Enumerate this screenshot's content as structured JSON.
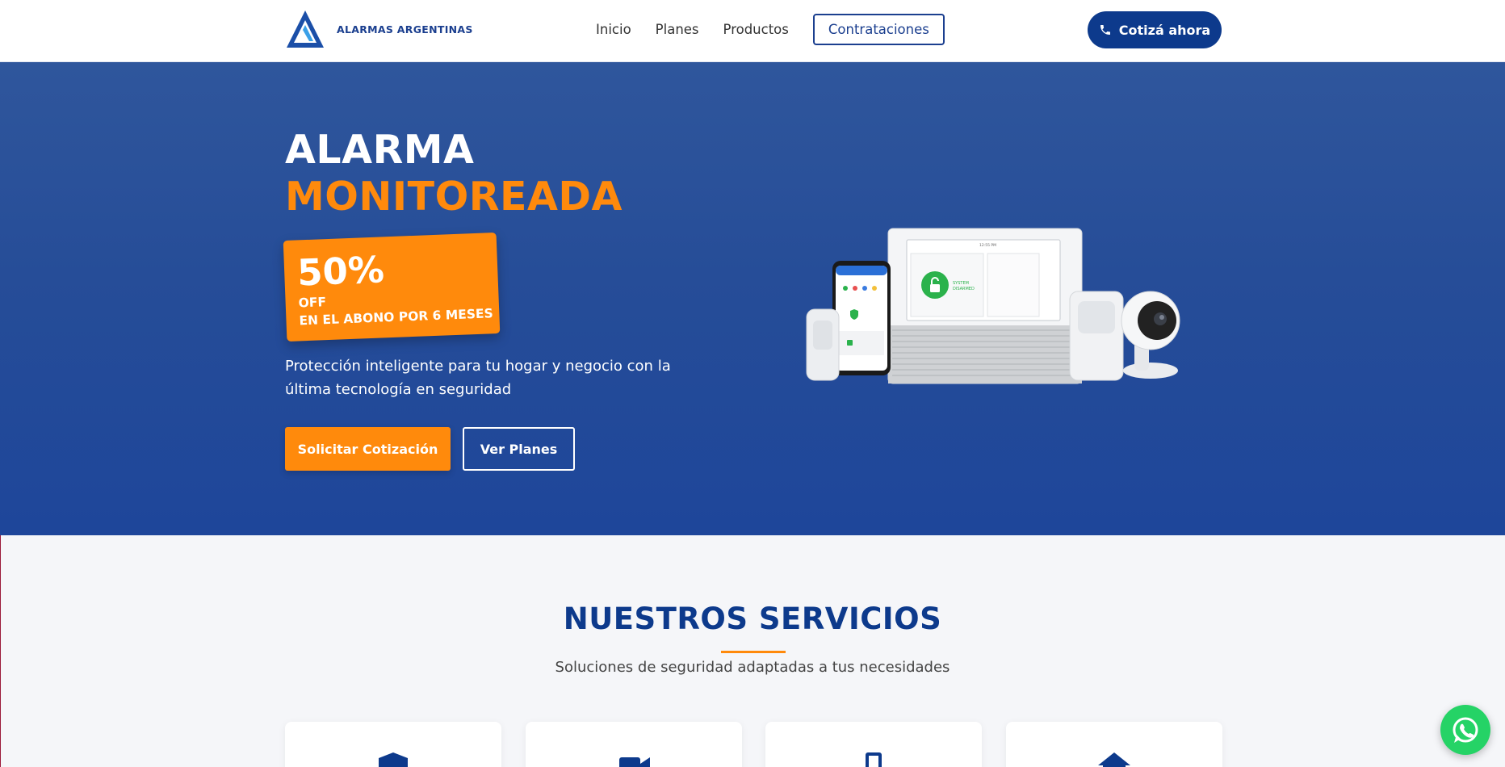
{
  "header": {
    "logo_text": "ALARMAS ARGENTINAS",
    "nav": [
      "Inicio",
      "Planes",
      "Productos"
    ],
    "nav_button": "Contrataciones",
    "cta": "Cotizá ahora"
  },
  "hero": {
    "title_line1": "ALARMA",
    "title_line2": "MONITOREADA",
    "promo_big": "50%",
    "promo_line1": "OFF",
    "promo_line2": "EN EL ABONO POR 6 MESES",
    "description": "Protección inteligente para tu hogar y negocio con la última tecnología en seguridad",
    "btn_primary": "Solicitar Cotización",
    "btn_secondary": "Ver Planes"
  },
  "device_screen": {
    "status_line1": "SYSTEM",
    "status_line2": "DISARMED",
    "time": "12:55 PM"
  },
  "services": {
    "title": "NUESTROS SERVICIOS",
    "subtitle": "Soluciones de seguridad adaptadas a tus necesidades",
    "cards": [
      {
        "icon": "shield-icon"
      },
      {
        "icon": "video-camera-icon"
      },
      {
        "icon": "mobile-phone-icon"
      },
      {
        "icon": "home-icon"
      }
    ]
  },
  "colors": {
    "brand_blue": "#0d3a8c",
    "accent_orange": "#ff8a0c",
    "whatsapp_green": "#25d366"
  }
}
